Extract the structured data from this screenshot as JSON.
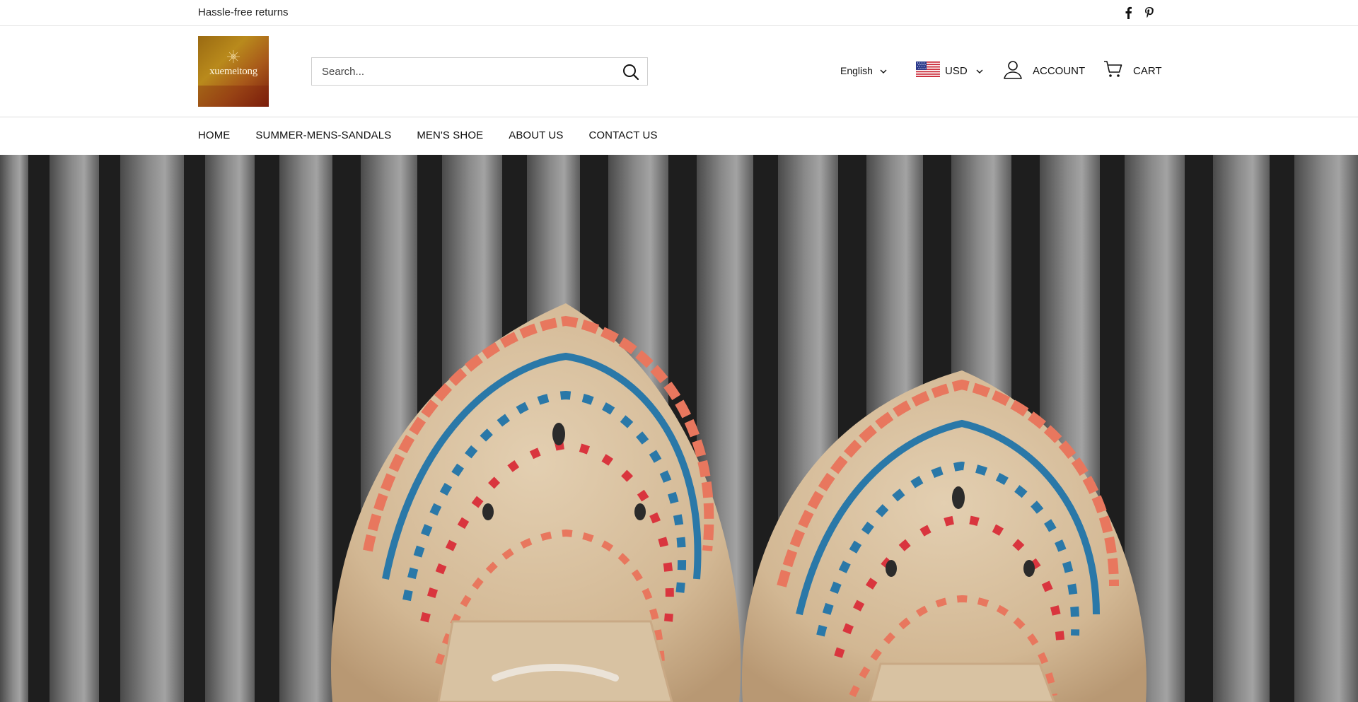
{
  "announcement": {
    "text": "Hassle-free returns"
  },
  "social": {
    "icons": [
      "facebook-icon",
      "pinterest-icon"
    ]
  },
  "logo": {
    "text": "xuemeitong"
  },
  "search": {
    "placeholder": "Search..."
  },
  "language": {
    "selected": "English"
  },
  "currency": {
    "selected": "USD",
    "flag": "us-flag-icon"
  },
  "account": {
    "label": "ACCOUNT"
  },
  "cart": {
    "label": "CART"
  },
  "nav": {
    "items": [
      {
        "label": "HOME"
      },
      {
        "label": "SUMMER-MENS-SANDALS"
      },
      {
        "label": "MEN'S SHOE"
      },
      {
        "label": "ABOUT US"
      },
      {
        "label": "CONTACT US"
      }
    ]
  },
  "hero": {
    "image": "woven-leather-shoes-on-wooden-deck"
  },
  "colors": {
    "text": "#1a1a1a",
    "border": "#dcdcdc",
    "logo_gold": "#b98a1c",
    "logo_red": "#7a1d0c",
    "stitch_coral": "#e8775e",
    "stitch_blue": "#2a78a8",
    "stitch_red": "#d9353e",
    "leather": "#d9c2a3"
  }
}
